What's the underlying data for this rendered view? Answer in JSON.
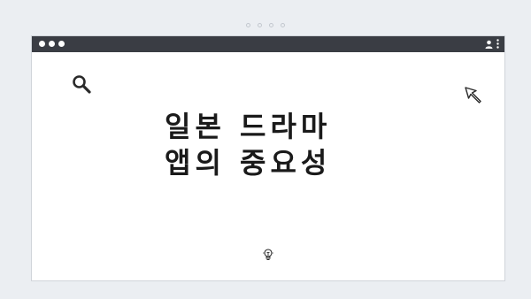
{
  "window": {
    "traffic_lights": [
      "close",
      "minimize",
      "maximize"
    ],
    "titlebar_icons": [
      "user-icon",
      "kebab-menu-icon"
    ]
  },
  "page_indicator": {
    "count": 4
  },
  "content": {
    "headline_line_1": "일본 드라마",
    "headline_line_2": "앱의 중요성"
  },
  "icons": {
    "search": "search-icon",
    "cursor": "cursor-arrow-icon",
    "bottom": "lightbulb-icon"
  },
  "colors": {
    "background": "#ebeef2",
    "titlebar": "#3a3d44",
    "text": "#1a1a1a",
    "window": "#ffffff"
  }
}
